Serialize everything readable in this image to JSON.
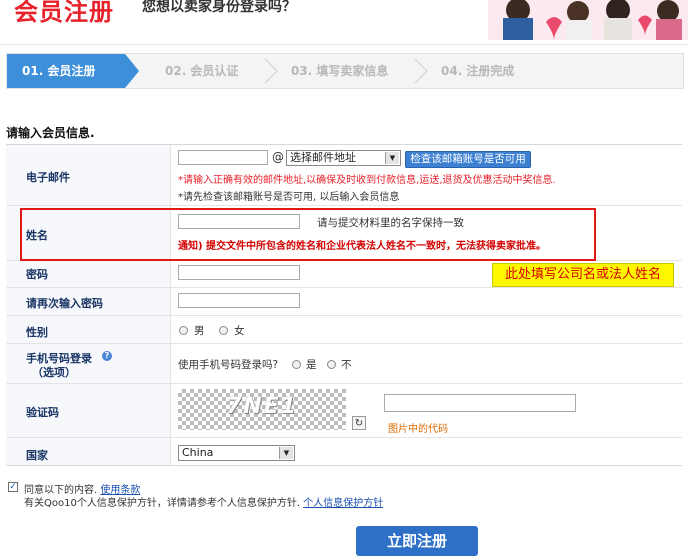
{
  "header": {
    "logo": "会员注册",
    "slogan": "您想以卖家身份登录吗？"
  },
  "steps": [
    {
      "label": "01. 会员注册",
      "active": true
    },
    {
      "label": "02. 会员认证",
      "active": false
    },
    {
      "label": "03. 填写卖家信息",
      "active": false
    },
    {
      "label": "04. 注册完成",
      "active": false
    }
  ],
  "form": {
    "title": "请输入会员信息.",
    "email": {
      "label": "电子邮件",
      "at": "@",
      "domain_select": "选择邮件地址",
      "check_button": "检查该邮箱账号是否可用",
      "note1": "*请输入正确有效的邮件地址,以确保及时收到付款信息,运送,退货及优惠活动中奖信息.",
      "note2": "*请先检查该邮箱账号是否可用, 以后输入会员信息"
    },
    "name": {
      "label": "姓名",
      "hint": "请与提交材料里的名字保持一致",
      "notice": "通知) 提交文件中所包含的姓名和企业代表法人姓名不一致时，无法获得卖家批准。"
    },
    "callout": "此处填写公司名或法人姓名",
    "password": {
      "label": "密码"
    },
    "password_confirm": {
      "label": "请再次输入密码"
    },
    "gender": {
      "label": "性别",
      "male": "男",
      "female": "女"
    },
    "phone_login": {
      "label_line1": "手机号码登录",
      "label_line2": "（选项）",
      "question": "使用手机号码登录吗?",
      "yes": "是",
      "no": "不"
    },
    "captcha": {
      "label": "验证码",
      "image_text": "7NE1",
      "hint": "图片中的代码"
    },
    "country": {
      "label": "国家",
      "value": "China"
    }
  },
  "agreement": {
    "line1_prefix": "同意以下的内容.",
    "terms_link": "使用条款",
    "line2_prefix": "有关Qoo10个人信息保护方针，详情请参考个人信息保护方针.",
    "privacy_link": "个人信息保护方针"
  },
  "submit_label": "立即注册",
  "colors": {
    "accent_blue": "#3d8fd9",
    "brand_red": "#e8222b",
    "callout_yellow": "#fff700"
  }
}
